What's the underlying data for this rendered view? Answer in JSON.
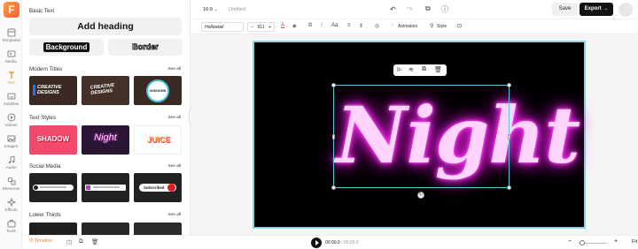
{
  "app": {
    "logo": "F",
    "title": "Untitled",
    "ratio": "16:9"
  },
  "rail": [
    {
      "label": "Templates",
      "icon": "templates-icon"
    },
    {
      "label": "Media",
      "icon": "media-icon"
    },
    {
      "label": "Text",
      "icon": "text-icon",
      "active": true
    },
    {
      "label": "Subtitles",
      "icon": "subtitles-icon"
    },
    {
      "label": "Videos",
      "icon": "videos-icon"
    },
    {
      "label": "Images",
      "icon": "images-icon"
    },
    {
      "label": "Audio",
      "icon": "audio-icon"
    },
    {
      "label": "Elements",
      "icon": "elements-icon"
    },
    {
      "label": "Effects",
      "icon": "effects-icon"
    },
    {
      "label": "Tools",
      "icon": "tools-icon"
    }
  ],
  "panel": {
    "basic_text": "Basic Text",
    "add_heading": "Add heading",
    "background": "Background",
    "border": "Border",
    "modern_titles": "Modern Titles",
    "text_styles": "Text Styles",
    "social_media": "Social Media",
    "lower_thirds": "Lower Thirds",
    "see_all": "See all",
    "modern_thumbs": [
      "CREATIVE DESIGNS",
      "CREATIVE DESIGNS",
      "UNKNOWN"
    ],
    "style_thumbs": [
      "SHADOW",
      "Night",
      "JUICE"
    ],
    "social_thumbs": [
      "",
      "",
      "Subscribed"
    ]
  },
  "topbar": {
    "save": "Save",
    "export": "Export →"
  },
  "fmt": {
    "font": "Hollowtail",
    "size": "511",
    "animation": "Animation",
    "style": "Style"
  },
  "canvas": {
    "text": "Night"
  },
  "bottom": {
    "timeline": "Timeline",
    "current": "00:00.0",
    "total": "/ 00:05.0",
    "fit": "Fit"
  },
  "colors": {
    "accent": "#f29a3c",
    "neon": "#ff2cf1",
    "selection": "#54c6dd"
  }
}
